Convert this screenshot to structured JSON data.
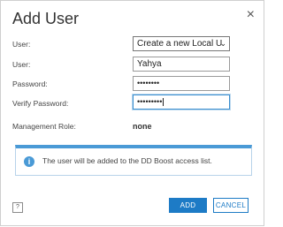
{
  "dialog": {
    "title": "Add User",
    "close_glyph": "×"
  },
  "form": {
    "user_type_label": "User:",
    "user_type_value": "Create a new Local U",
    "user_label": "User:",
    "user_value": "Yahya",
    "password_label": "Password:",
    "password_value": "••••••••",
    "verify_password_label": "Verify Password:",
    "verify_password_value": "•••••••••",
    "management_role_label": "Management Role:",
    "management_role_value": "none"
  },
  "info": {
    "icon": "i",
    "text": "The user will be added to the DD Boost access list."
  },
  "footer": {
    "help_glyph": "?",
    "add_label": "ADD",
    "cancel_label": "CANCEL"
  },
  "colors": {
    "accent": "#1d7bc6",
    "info_border": "#4a9ad6"
  }
}
